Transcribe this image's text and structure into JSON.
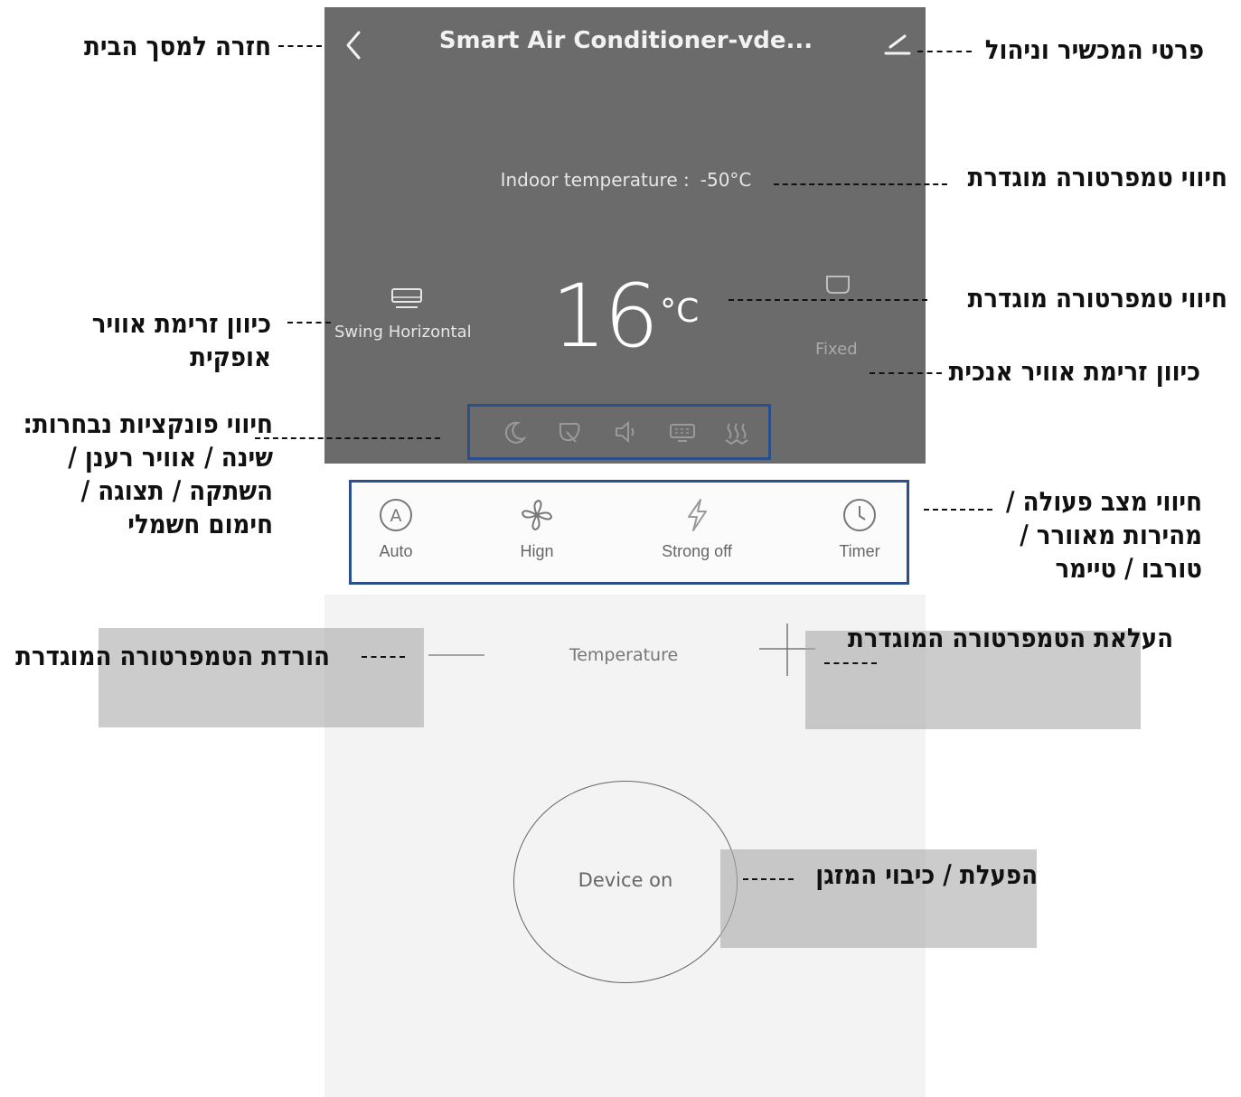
{
  "app": {
    "title": "Smart Air Conditioner-vde...",
    "indoor_label": "Indoor temperature :",
    "indoor_value": "-50°C",
    "set_temp": "16",
    "set_temp_unit": "°C",
    "swing_h_label": "Swing Horizontal",
    "swing_v_label": "Fixed",
    "function_icons": [
      "moon-icon",
      "leaf-icon",
      "speaker-icon",
      "display-icon",
      "heating-icon"
    ],
    "modes": [
      {
        "icon": "auto-icon",
        "label": "Auto"
      },
      {
        "icon": "fan-icon",
        "label": "Hign"
      },
      {
        "icon": "lightning-icon",
        "label": "Strong off"
      },
      {
        "icon": "clock-icon",
        "label": "Timer"
      }
    ],
    "temperature_label": "Temperature",
    "power_label": "Device on"
  },
  "annotations": {
    "back_home": "חזרה למסך הבית",
    "device_details": "פרטי המכשיר וניהול",
    "indoor_temp": "חיווי טמפרטורה מוגדרת",
    "set_temp": "חיווי טמפרטורה מוגדרת",
    "swing_horizontal": "כיוון זרימת אוויר\nאופקית",
    "swing_vertical": "כיוון זרימת אוויר אנכית",
    "functions": "חיווי פונקציות נבחרות:\nשינה / אוויר רענן /\nהשתקה / תצוגה /\nחימום חשמלי",
    "modes": "חיווי מצב פעולה /\nמהירות מאוורר /\nטורבו / טיימר",
    "temp_down": "הורדת הטמפרטורה המוגדרת",
    "temp_up": "העלאת הטמפרטורה המוגדרת",
    "power": "הפעלת / כיבוי המזגן"
  },
  "colors": {
    "panel_dark": "#6b6b6b",
    "panel_light": "#f3f3f3",
    "highlight_border": "#2b4f8a"
  }
}
